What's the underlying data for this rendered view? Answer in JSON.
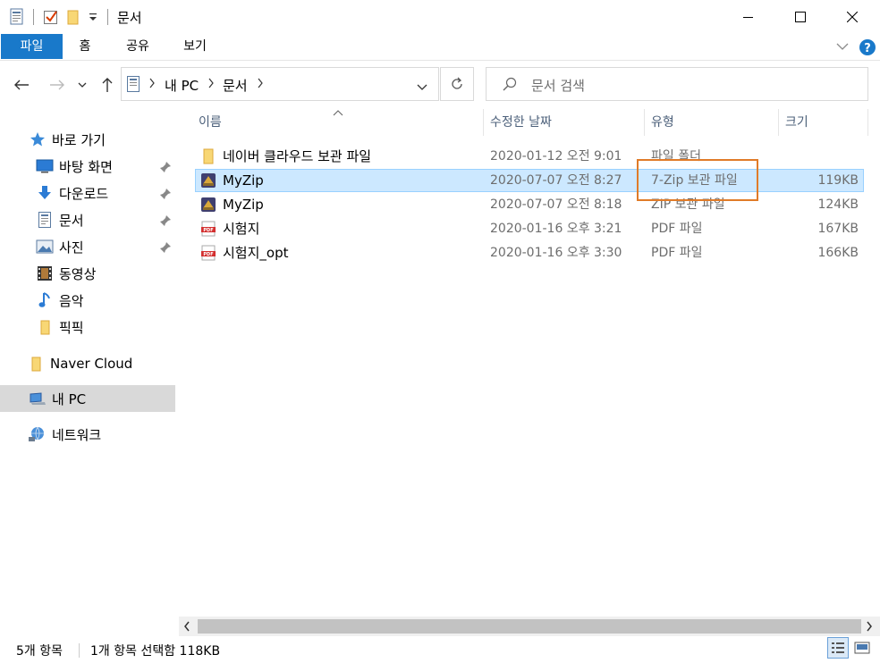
{
  "window": {
    "title": "문서"
  },
  "ribbon": {
    "tabs": [
      "파일",
      "홈",
      "공유",
      "보기"
    ]
  },
  "address": {
    "crumbs": [
      "내 PC",
      "문서"
    ]
  },
  "search": {
    "placeholder": "문서 검색"
  },
  "nav": {
    "quick_access": "바로 가기",
    "items": [
      "바탕 화면",
      "다운로드",
      "문서",
      "사진",
      "동영상",
      "음악",
      "픽픽"
    ],
    "naver_cloud": "Naver Cloud",
    "this_pc": "내 PC",
    "network": "네트워크"
  },
  "columns": {
    "name": "이름",
    "date": "수정한 날짜",
    "type": "유형",
    "size": "크기"
  },
  "files": [
    {
      "name": "네이버 클라우드 보관 파일",
      "date": "2020-01-12 오전 9:01",
      "type": "파일 폴더",
      "size": "",
      "icon": "folder-icon"
    },
    {
      "name": "MyZip",
      "date": "2020-07-07 오전 8:27",
      "type": "7-Zip 보관 파일",
      "size": "119KB",
      "icon": "archive-icon"
    },
    {
      "name": "MyZip",
      "date": "2020-07-07 오전 8:18",
      "type": "ZIP 보관 파일",
      "size": "124KB",
      "icon": "archive-icon"
    },
    {
      "name": "시험지",
      "date": "2020-01-16 오후 3:21",
      "type": "PDF 파일",
      "size": "167KB",
      "icon": "pdf-icon"
    },
    {
      "name": "시험지_opt",
      "date": "2020-01-16 오후 3:30",
      "type": "PDF 파일",
      "size": "166KB",
      "icon": "pdf-icon"
    }
  ],
  "status": {
    "item_count": "5개 항목",
    "selection": "1개 항목 선택함 118KB"
  },
  "colors": {
    "accent": "#1979ca",
    "selection": "#cce8ff",
    "highlight": "#e07b28"
  }
}
